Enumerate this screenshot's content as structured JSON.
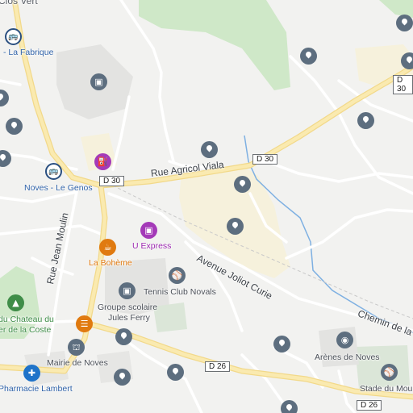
{
  "colors": {
    "background": "#f2f2f0",
    "park": "#cfe8c8",
    "major_road": "#f9e8a3",
    "minor_road": "#ffffff",
    "poi_grey": "#5d6e7f",
    "shop": "#a43ab8",
    "food": "#e07a10",
    "water": "#6fa7dd"
  },
  "places": {
    "clos_vert": "Clos Vert"
  },
  "bus_stops": [
    {
      "name": "- La Fabrique",
      "icon": "bus-icon"
    },
    {
      "name": "Noves - Le Genos",
      "icon": "bus-icon"
    }
  ],
  "roads": {
    "d30_a": "D 30",
    "d30_b": "D 30",
    "d30_c": "D 30",
    "d26_a": "D 26",
    "d26_b": "D 26"
  },
  "streets": {
    "agricol_viala": "Rue Agricol Viala",
    "jean_moulin": "Rue Jean Moulin",
    "joliot_curie": "Avenue Joliot Curie",
    "chemin": "Chemin de la"
  },
  "pois": {
    "u_express": {
      "name": "U Express",
      "icon": "shopping-cart-icon"
    },
    "la_boheme": {
      "name": "La Bohème",
      "icon": "restaurant-icon"
    },
    "tennis": {
      "name": "Tennis Club Novals",
      "icon": "tennis-icon"
    },
    "school_line1": "Groupe scolaire",
    "school_line2": "Jules Ferry",
    "school_icon": "school-icon",
    "chateau_line1": "du Chateau du",
    "chateau_line2": "er de la Coste",
    "chateau_icon": "tree-icon",
    "mairie": {
      "name": "Mairie de Noves",
      "icon": "town-hall-icon"
    },
    "pharmacie": {
      "name": "Pharmacie Lambert",
      "icon": "pharmacy-icon"
    },
    "arenes": {
      "name": "Arènes de Noves",
      "icon": "arena-icon"
    },
    "stade": {
      "name": "Stade du Moulin",
      "icon": "stadium-icon"
    },
    "fuel_icon": "fuel-icon",
    "building_icon": "building-icon",
    "cafe_icon": "cafe-icon"
  },
  "pin_icon": "location-pin-icon"
}
